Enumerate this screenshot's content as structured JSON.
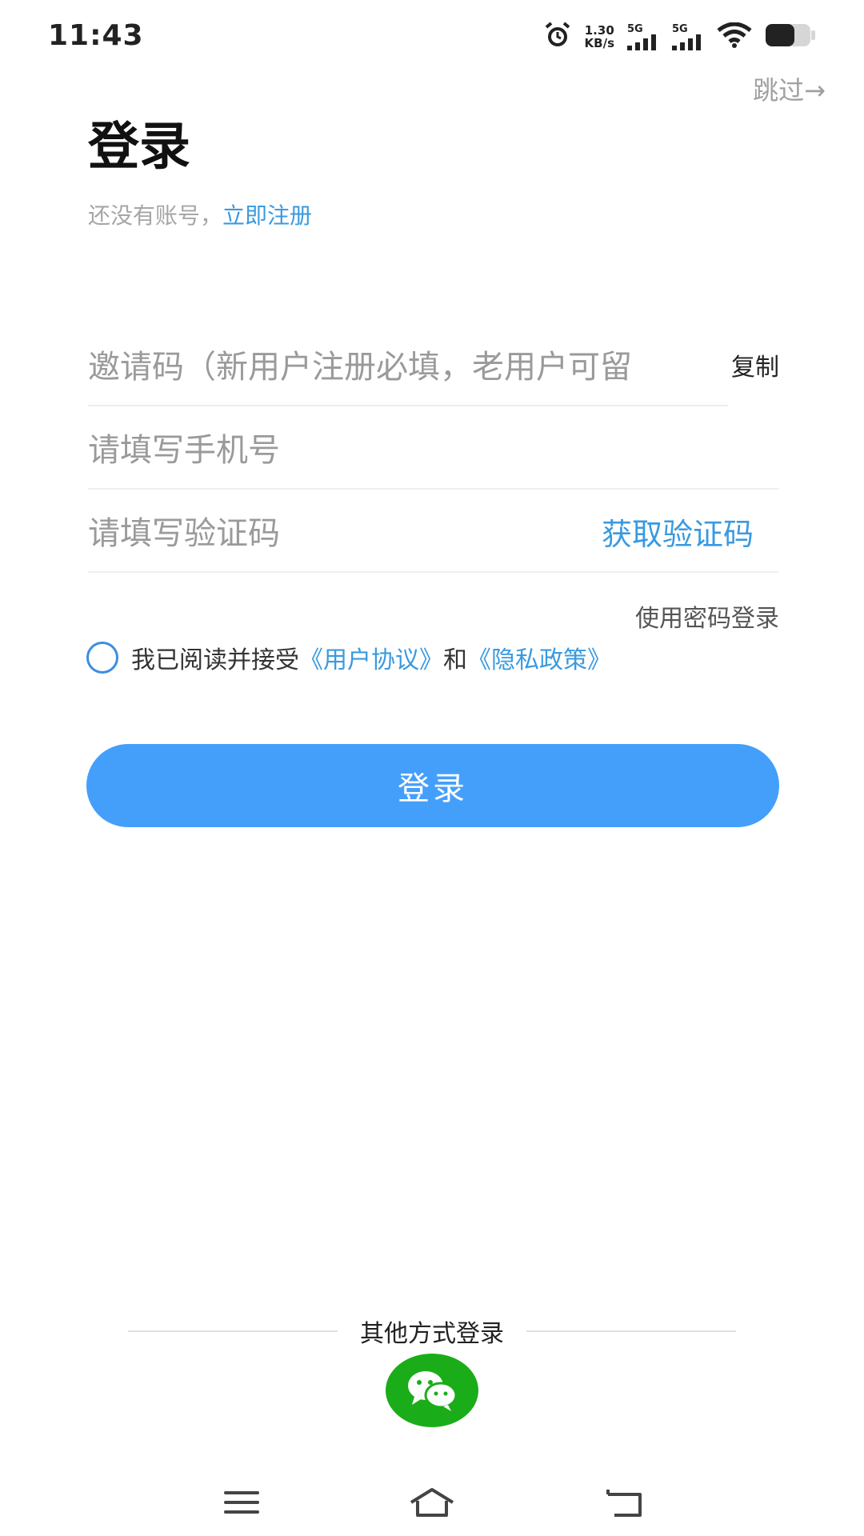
{
  "status_bar": {
    "time": "11:43",
    "alarm_icon": "alarm-clock-icon",
    "speed_value": "1.30",
    "speed_unit": "KB/s",
    "signal_1": "5G",
    "signal_2": "5G",
    "wifi_icon": "wifi-icon",
    "battery_icon": "battery-icon"
  },
  "header": {
    "skip": "跳过→",
    "title": "登录",
    "no_account": "还没有账号，",
    "register": "立即注册"
  },
  "form": {
    "invite_placeholder": "邀请码（新用户注册必填，老用户可留",
    "copy": "复制",
    "phone_placeholder": "请填写手机号",
    "code_placeholder": "请填写验证码",
    "get_code": "获取验证码",
    "password_login": "使用密码登录"
  },
  "agreement": {
    "prefix": "我已阅读并接受",
    "user_agreement": "《用户协议》",
    "and": "和",
    "privacy_policy": "《隐私政策》"
  },
  "login_button": "登录",
  "other_login": {
    "label": "其他方式登录",
    "wechat_icon": "wechat-icon"
  },
  "nav_bar": {
    "menu_icon": "menu-icon",
    "home_icon": "home-icon",
    "back_icon": "back-icon"
  },
  "colors": {
    "accent": "#449ffb",
    "link": "#3a9ae0",
    "wechat": "#1aad19"
  }
}
